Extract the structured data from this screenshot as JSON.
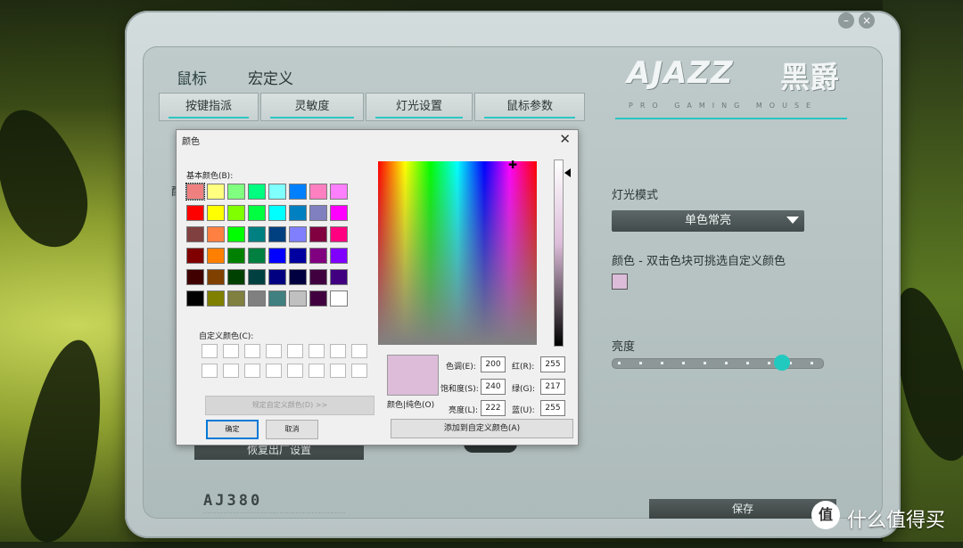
{
  "app": {
    "nav_tabs": [
      {
        "label": "鼠标"
      },
      {
        "label": "宏定义"
      }
    ],
    "sub_tabs": [
      {
        "label": "按键指派"
      },
      {
        "label": "灵敏度"
      },
      {
        "label": "灯光设置"
      },
      {
        "label": "鼠标参数"
      }
    ],
    "logo": "AJAZZ",
    "logo_cn": "黑爵",
    "tagline": "PRO GAMING MOUSE",
    "light_mode_label": "灯光模式",
    "light_mode_value": "单色常亮",
    "color_label": "颜色 - 双击色块可挑选自定义颜色",
    "color_value": "#dcbcd9",
    "brightness_label": "亮度",
    "brightness_level": 0.83,
    "restore_button": "恢复出厂设置",
    "save_button": "保存",
    "model": "AJ380",
    "partial_left_label": "配",
    "accent_color": "#2ec7c4"
  },
  "dialog": {
    "title": "颜色",
    "basic_colors_label": "基本颜色(B):",
    "custom_colors_label": "自定义颜色(C):",
    "basic_colors": [
      "#f08080",
      "#ffff80",
      "#80ff80",
      "#00ff80",
      "#80ffff",
      "#0080ff",
      "#ff80c0",
      "#ff80ff",
      "#ff0000",
      "#ffff00",
      "#80ff00",
      "#00ff40",
      "#00ffff",
      "#0080c0",
      "#8080c0",
      "#ff00ff",
      "#804040",
      "#ff8040",
      "#00ff00",
      "#008080",
      "#004080",
      "#8080ff",
      "#800040",
      "#ff0080",
      "#800000",
      "#ff8000",
      "#008000",
      "#008040",
      "#0000ff",
      "#0000a0",
      "#800080",
      "#8000ff",
      "#400000",
      "#804000",
      "#004000",
      "#004040",
      "#000080",
      "#000040",
      "#400040",
      "#400080",
      "#000000",
      "#808000",
      "#808040",
      "#808080",
      "#408080",
      "#c0c0c0",
      "#400040",
      "#ffffff"
    ],
    "define_custom_button": "规定自定义颜色(D) >>",
    "ok_button": "确定",
    "cancel_button": "取消",
    "preview_label": "颜色|纯色(O)",
    "hue_label": "色调(E):",
    "hue_value": "200",
    "sat_label": "饱和度(S):",
    "sat_value": "240",
    "lum_label": "亮度(L):",
    "lum_value": "222",
    "red_label": "红(R):",
    "red_value": "255",
    "green_label": "绿(G):",
    "green_value": "217",
    "blue_label": "蓝(U):",
    "blue_value": "255",
    "add_custom_button": "添加到自定义颜色(A)"
  },
  "watermark": {
    "icon": "值",
    "text": "什么值得买"
  }
}
